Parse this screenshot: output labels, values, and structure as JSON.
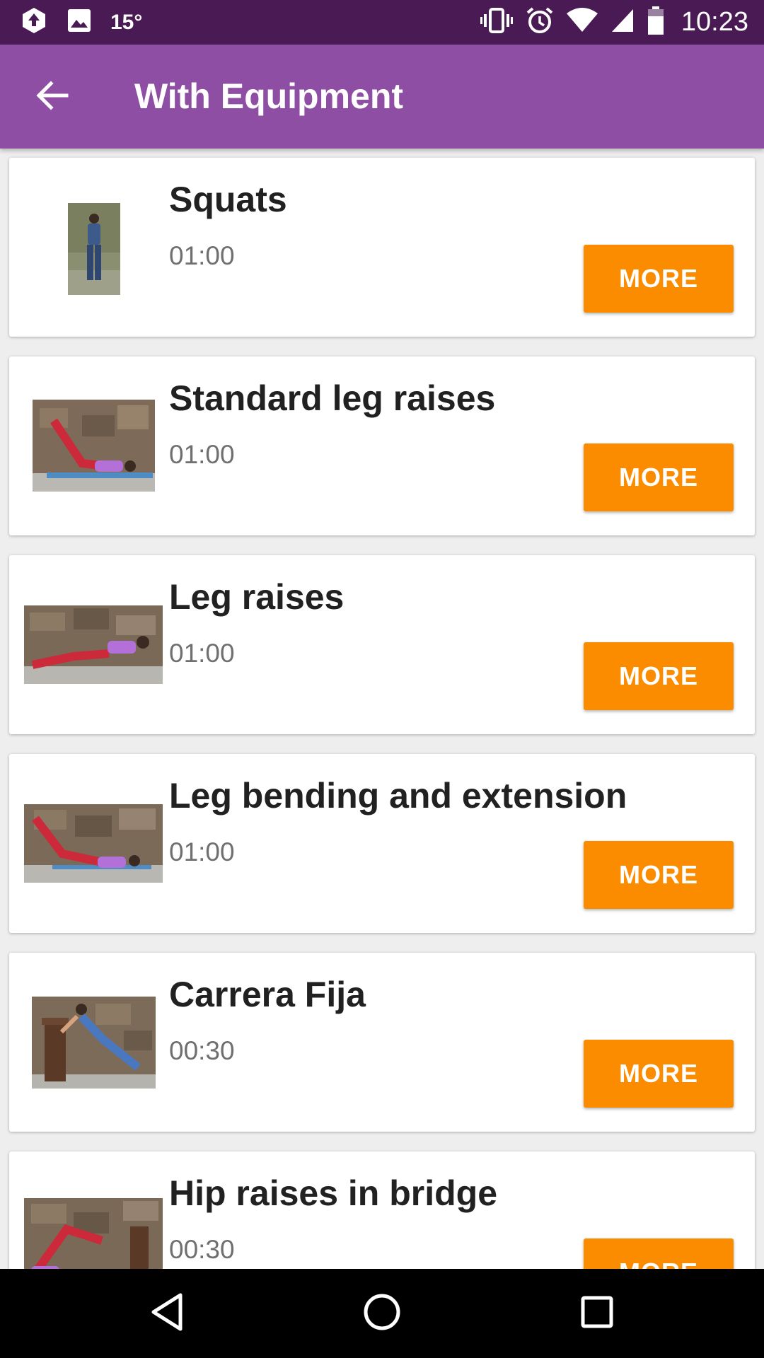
{
  "status_bar": {
    "temperature": "15°",
    "time": "10:23",
    "icons": [
      "upload-icon",
      "image-icon",
      "vibrate-icon",
      "alarm-icon",
      "wifi-icon",
      "signal-icon",
      "battery-icon"
    ]
  },
  "app_bar": {
    "title": "With Equipment",
    "back_icon": "arrow-back-icon"
  },
  "exercises": [
    {
      "name": "Squats",
      "duration": "01:00",
      "button": "MORE"
    },
    {
      "name": "Standard leg raises",
      "duration": "01:00",
      "button": "MORE"
    },
    {
      "name": "Leg raises",
      "duration": "01:00",
      "button": "MORE"
    },
    {
      "name": "Leg bending and extension",
      "duration": "01:00",
      "button": "MORE"
    },
    {
      "name": "Carrera Fija",
      "duration": "00:30",
      "button": "MORE"
    },
    {
      "name": "Hip raises in bridge",
      "duration": "00:30",
      "button": "MORE"
    }
  ],
  "nav_bar": {
    "icons": [
      "back-triangle-icon",
      "home-circle-icon",
      "recents-square-icon"
    ]
  },
  "colors": {
    "status_bar": "#4a1a55",
    "app_bar": "#8e4ea3",
    "accent": "#fb8c00",
    "background": "#eeeeee"
  }
}
